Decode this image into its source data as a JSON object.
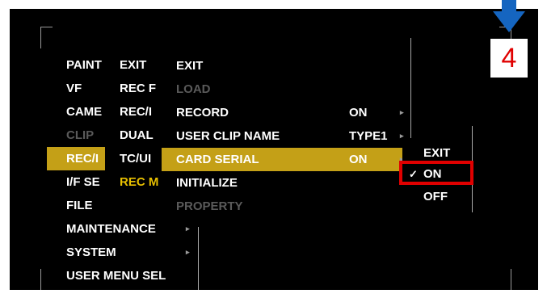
{
  "menu_level1": [
    {
      "label": "PAINT",
      "style": "normal"
    },
    {
      "label": "VF",
      "style": "normal"
    },
    {
      "label": "CAME",
      "style": "normal"
    },
    {
      "label": "CLIP",
      "style": "dim"
    },
    {
      "label": "REC/I",
      "style": "highlight"
    },
    {
      "label": "I/F SE",
      "style": "normal"
    },
    {
      "label": "FILE",
      "style": "normal"
    },
    {
      "label": "MAINTENANCE",
      "style": "normal",
      "arrow": "▸"
    },
    {
      "label": "SYSTEM",
      "style": "normal",
      "arrow": "▸"
    },
    {
      "label": "USER MENU SEL",
      "style": "normal"
    }
  ],
  "menu_level2": [
    {
      "label": "EXIT"
    },
    {
      "label": "REC F"
    },
    {
      "label": "REC/I"
    },
    {
      "label": "DUAL"
    },
    {
      "label": "TC/UI"
    },
    {
      "label": "REC M",
      "selected": true
    }
  ],
  "menu_level3": [
    {
      "label": "EXIT",
      "style": "normal"
    },
    {
      "label": "LOAD",
      "style": "dim"
    },
    {
      "label": "RECORD",
      "value": "ON",
      "arrow": "▸",
      "style": "normal"
    },
    {
      "label": "USER CLIP NAME",
      "value": "TYPE1",
      "arrow": "▸",
      "style": "normal"
    },
    {
      "label": "CARD SERIAL",
      "value": "ON",
      "arrow": "▸",
      "style": "highlight"
    },
    {
      "label": "INITIALIZE",
      "style": "normal"
    },
    {
      "label": "PROPERTY",
      "style": "dim"
    }
  ],
  "menu_level4": {
    "items": [
      {
        "label": "EXIT"
      },
      {
        "label": "ON",
        "check": "✓"
      },
      {
        "label": "OFF"
      }
    ]
  },
  "annotation": {
    "step_number": "4"
  },
  "colors": {
    "highlight": "#c4a017",
    "selected_text": "#e8c000",
    "dim": "#5a5a5a",
    "annotation": "#e00000",
    "arrow": "#1565c0"
  }
}
